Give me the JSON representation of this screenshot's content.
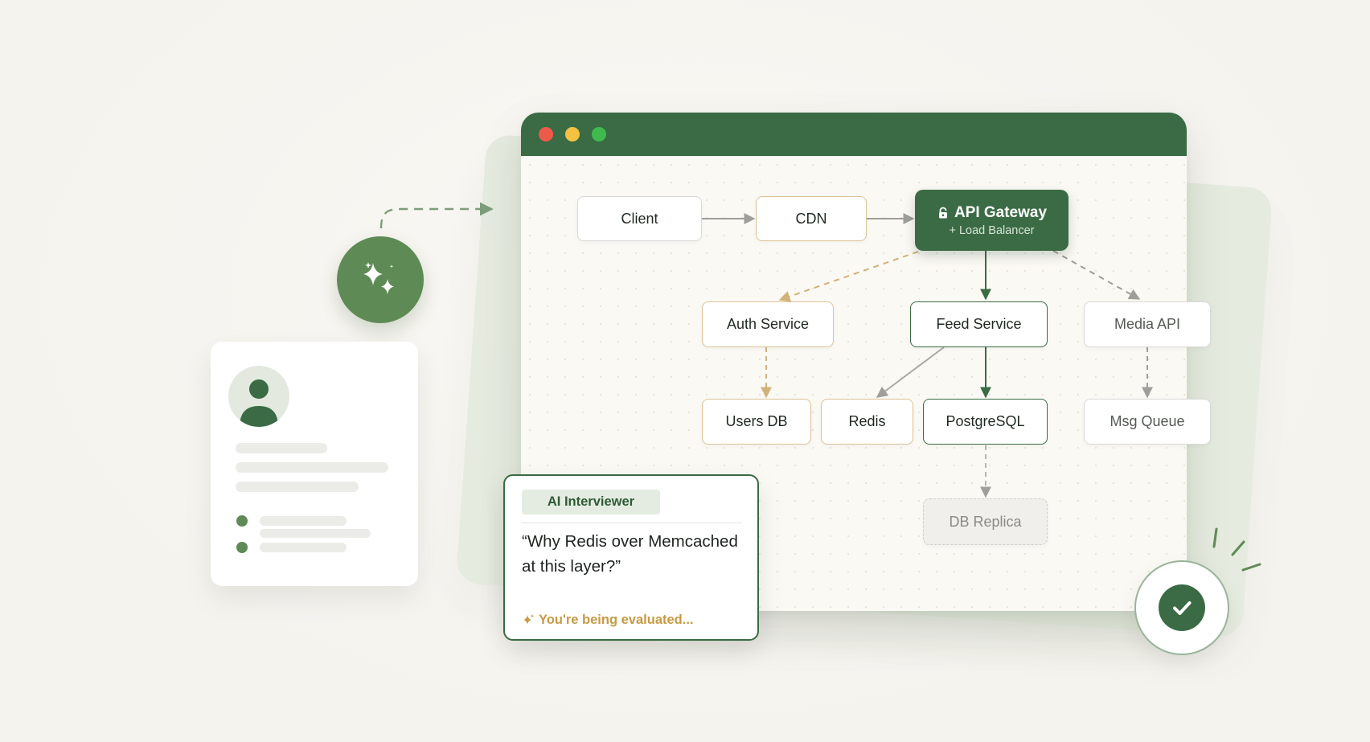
{
  "browser": {
    "window_controls": [
      "close",
      "minimize",
      "maximize"
    ]
  },
  "diagram": {
    "nodes": {
      "client": "Client",
      "cdn": "CDN",
      "api_gateway_title": "API Gateway",
      "api_gateway_subtitle": "+ Load Balancer",
      "auth_service": "Auth Service",
      "feed_service": "Feed Service",
      "media_api": "Media API",
      "users_db": "Users DB",
      "redis": "Redis",
      "postgresql": "PostgreSQL",
      "msg_queue": "Msg Queue",
      "db_replica": "DB Replica"
    }
  },
  "ai_card": {
    "badge": "AI Interviewer",
    "question": "“Why Redis over Memcached at this layer?”",
    "status": "You're being evaluated..."
  },
  "colors": {
    "brand_green": "#3a6b44",
    "accent_tan": "#dcc497",
    "eval_gold": "#c59a45",
    "background": "#f8f6f1"
  },
  "icons": {
    "sparkle": "sparkle-icon",
    "lock": "lock-icon",
    "check": "check-icon",
    "user": "user-avatar-icon"
  }
}
